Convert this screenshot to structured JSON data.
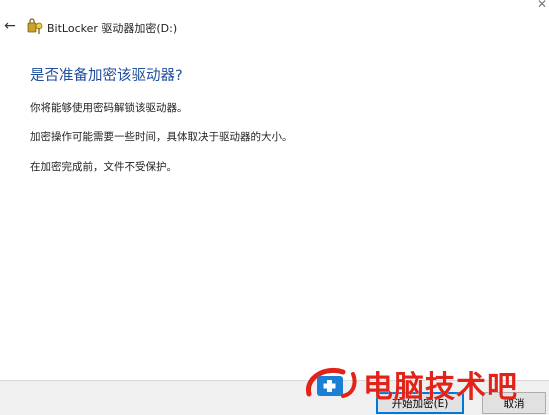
{
  "window": {
    "title": "BitLocker 驱动器加密(D:)",
    "back_icon": "back-arrow-icon",
    "app_icon": "bitlocker-key-icon"
  },
  "main": {
    "heading": "是否准备加密该驱动器?",
    "paragraphs": [
      "你将能够使用密码解锁该驱动器。",
      "加密操作可能需要一些时间，具体取决于驱动器的大小。",
      "在加密完成前，文件不受保护。"
    ]
  },
  "footer": {
    "start_label": "开始加密(E)",
    "cancel_label": "取消"
  },
  "watermark": {
    "text": "电脑技术吧"
  },
  "colors": {
    "heading": "#1f4e9c",
    "footer_bg": "#f0f0f0",
    "watermark": "#e2231a",
    "focus_border": "#0078d7"
  }
}
